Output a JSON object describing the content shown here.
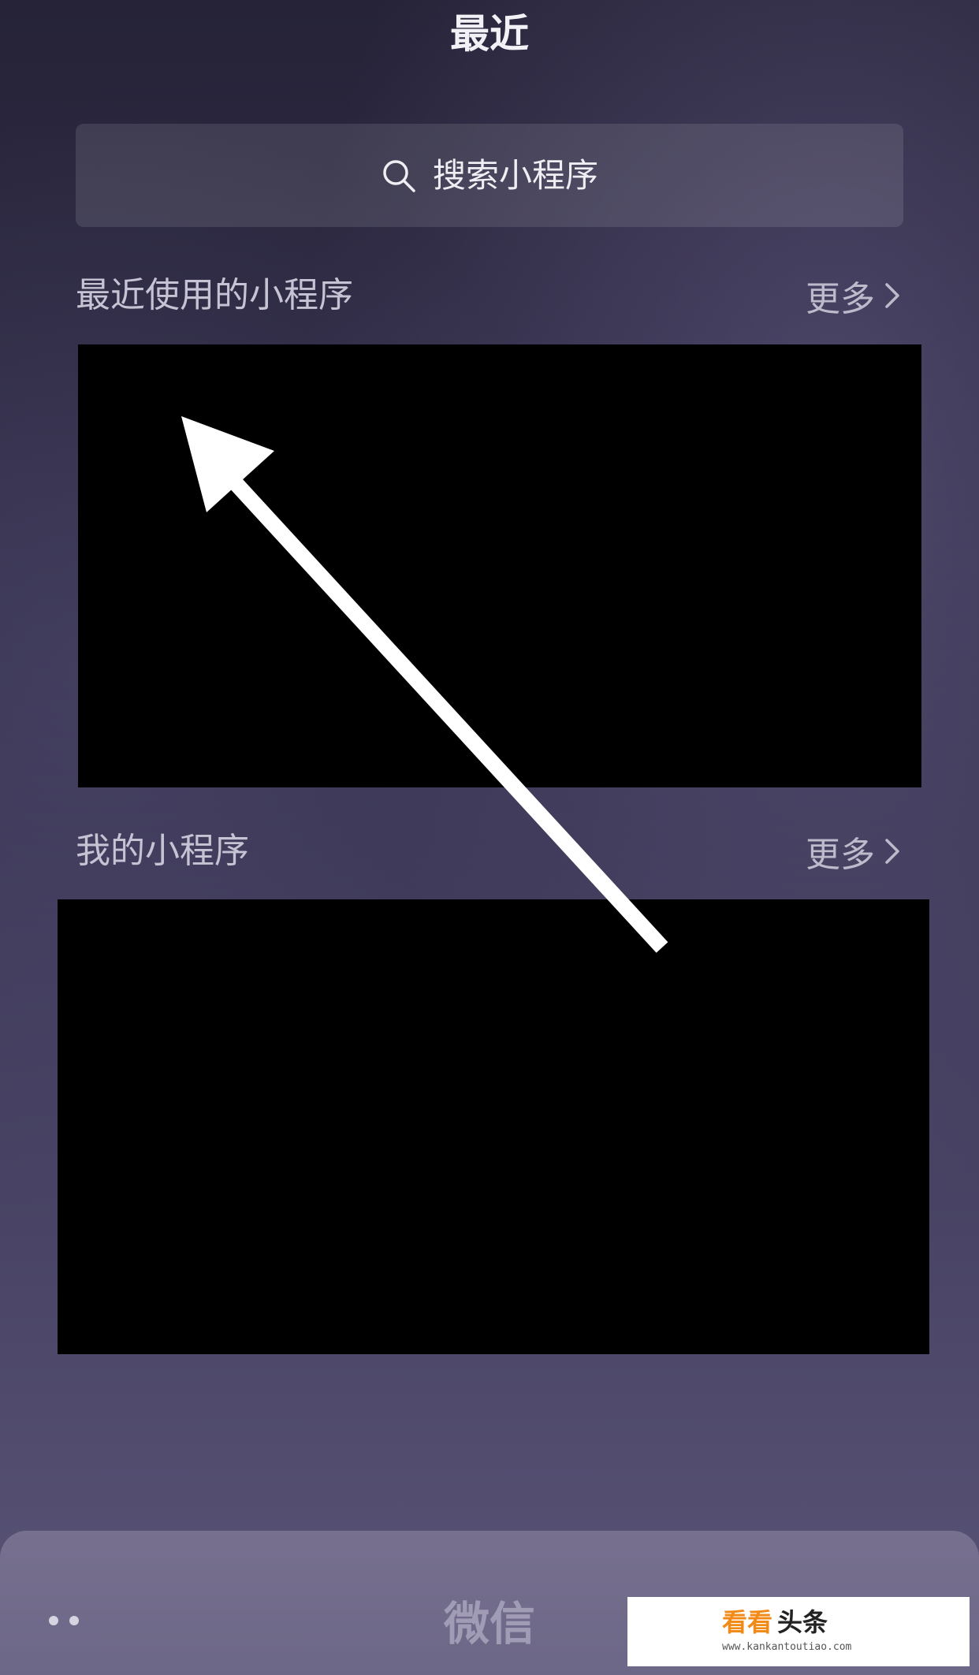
{
  "header": {
    "title": "最近"
  },
  "search": {
    "label": "搜索小程序",
    "icon": "search-icon"
  },
  "sections": [
    {
      "title": "最近使用的小程序",
      "more_label": "更多"
    },
    {
      "title": "我的小程序",
      "more_label": "更多"
    }
  ],
  "dock": {
    "label": "微信"
  },
  "watermark": {
    "brand_a": "看看",
    "brand_b": "头条",
    "url": "www.kankantoutiao.com"
  },
  "colors": {
    "annotation_arrow": "#ffffff",
    "watermark_accent": "#f28a17",
    "redaction": "#000000"
  }
}
